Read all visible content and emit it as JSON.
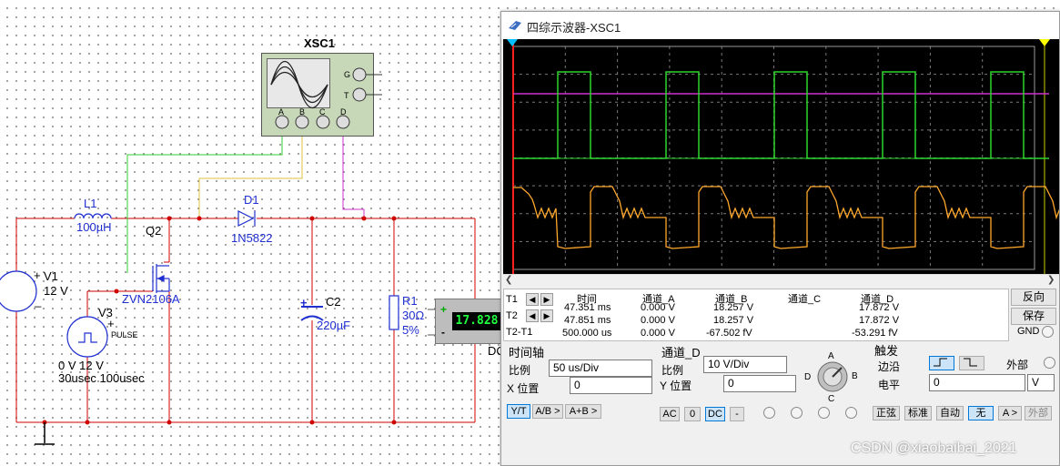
{
  "schematic": {
    "scope_label": "XSC1",
    "scope_ports": {
      "a": "A",
      "b": "B",
      "c": "C",
      "d": "D",
      "g": "G",
      "t": "T"
    },
    "l1": {
      "name": "L1",
      "value": "100µH"
    },
    "d1": {
      "name": "D1",
      "model": "1N5822"
    },
    "q2": {
      "name": "Q2",
      "model": "ZVN2106A"
    },
    "v1": {
      "name": "V1",
      "value": "12 V",
      "plus": "+",
      "minus": "_"
    },
    "v3": {
      "name": "V3",
      "plus": "+",
      "kind": "PULSE",
      "line1": "0 V 12 V",
      "line2": "30usec 100usec"
    },
    "c2": {
      "name": "C2",
      "value": "220µF",
      "plus": "+"
    },
    "r1": {
      "name": "R1",
      "value": "30Ω",
      "tol": "5%"
    },
    "meter": {
      "value": "17.828",
      "plus": "+",
      "minus": "-",
      "mode": "DC"
    }
  },
  "scope": {
    "title": "四综示波器-XSC1",
    "colors": {
      "a": "#2cd52c",
      "b": "#cc33cc",
      "c": "#ffffff",
      "d": "#ffa82c",
      "cursor1": "#00c0ff",
      "cursor2": "#ffff00"
    },
    "headers": {
      "time": "时间",
      "a": "通道_A",
      "b": "通道_B",
      "c": "通道_C",
      "d": "通道_D"
    },
    "rows": [
      {
        "label": "T1",
        "time": "47.351 ms",
        "a": "0.000 V",
        "b": "18.257 V",
        "c": "",
        "d": "17.872 V"
      },
      {
        "label": "T2",
        "time": "47.851 ms",
        "a": "0.000 V",
        "b": "18.257 V",
        "c": "",
        "d": "17.872 V"
      },
      {
        "label": "T2-T1",
        "time": "500.000 us",
        "a": "0.000 V",
        "b": "-67.502 fV",
        "c": "",
        "d": "-53.291 fV"
      }
    ],
    "right_buttons": {
      "reverse": "反向",
      "save": "保存",
      "gnd": "GND"
    },
    "timebase": {
      "title": "时间轴",
      "scale_label": "比例",
      "scale_value": "50 us/Div",
      "xpos_label": "X 位置",
      "xpos_value": "0",
      "yt": "Y/T",
      "ab": "A/B >",
      "apb": "A+B >"
    },
    "channel": {
      "title": "通道_D",
      "scale_label": "比例",
      "scale_value": "10 V/Div",
      "ypos_label": "Y 位置",
      "ypos_value": "0",
      "ac": "AC",
      "zero": "0",
      "dc": "DC",
      "minus": "-",
      "knob_a": "A",
      "knob_b": "B",
      "knob_c": "C",
      "knob_d": "D"
    },
    "trigger": {
      "title": "触发",
      "edge_label": "边沿",
      "external": "外部",
      "level_label": "电平",
      "level_value": "0",
      "level_unit": "V",
      "sine": "正弦",
      "standard": "标准",
      "auto": "自动",
      "none": "无",
      "a_btn": "A >",
      "ext_btn": "外部"
    }
  },
  "watermark": "CSDN @xiaobaibai_2021"
}
